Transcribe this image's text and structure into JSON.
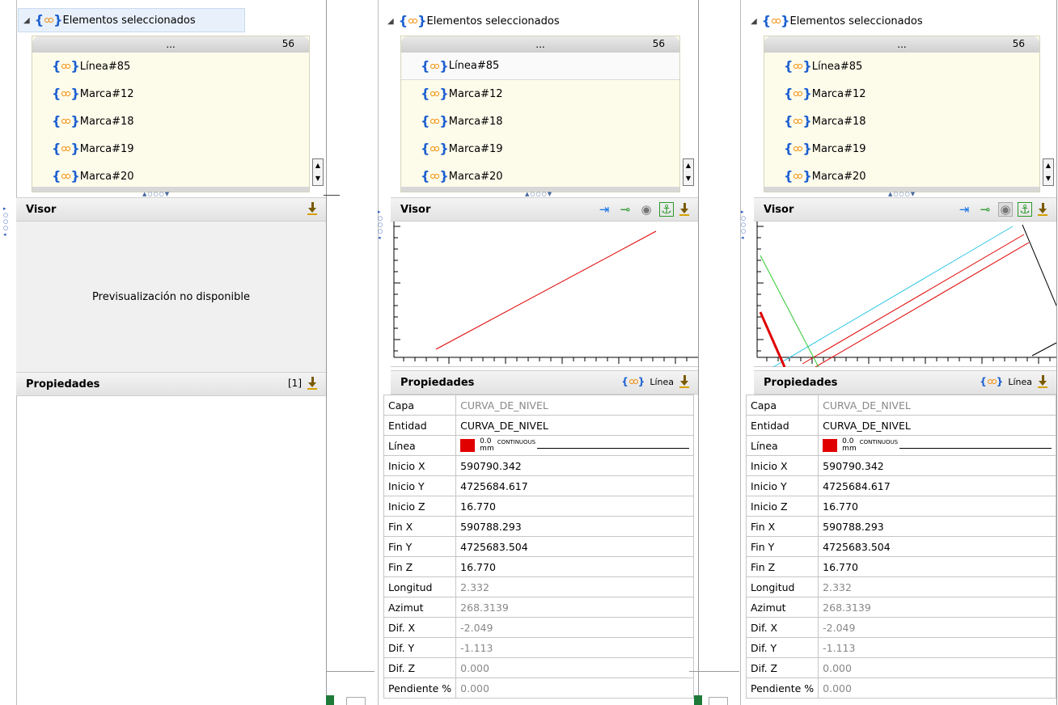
{
  "tree": {
    "title": "Elementos seleccionados",
    "header_ellipsis": "...",
    "header_count": "56",
    "items": [
      "Línea#85",
      "Marca#12",
      "Marca#18",
      "Marca#19",
      "Marca#20"
    ]
  },
  "viewer": {
    "label": "Visor",
    "unavailable": "Previsualización no disponible"
  },
  "properties": {
    "label": "Propiedades",
    "count_badge": "[1]",
    "entity_type": "Línea",
    "line_value": "0.0",
    "line_unit": "mm",
    "line_type": "CONTINUOUS",
    "rows": [
      {
        "key": "Capa",
        "value": "CURVA_DE_NIVEL",
        "muted": true
      },
      {
        "key": "Entidad",
        "value": "CURVA_DE_NIVEL",
        "muted": false
      },
      {
        "key": "Línea",
        "value": "",
        "muted": false
      },
      {
        "key": "Inicio X",
        "value": "590790.342",
        "muted": false
      },
      {
        "key": "Inicio Y",
        "value": "4725684.617",
        "muted": false
      },
      {
        "key": "Inicio Z",
        "value": "16.770",
        "muted": false
      },
      {
        "key": "Fin X",
        "value": "590788.293",
        "muted": false
      },
      {
        "key": "Fin Y",
        "value": "4725683.504",
        "muted": false
      },
      {
        "key": "Fin Z",
        "value": "16.770",
        "muted": false
      },
      {
        "key": "Longitud",
        "value": "2.332",
        "muted": true
      },
      {
        "key": "Azimut",
        "value": "268.3139",
        "muted": true
      },
      {
        "key": "Dif. X",
        "value": "-2.049",
        "muted": true
      },
      {
        "key": "Dif. Y",
        "value": "-1.113",
        "muted": true
      },
      {
        "key": "Dif. Z",
        "value": "0.000",
        "muted": true
      },
      {
        "key": "Pendiente %",
        "value": "0.000",
        "muted": true
      }
    ]
  },
  "colors": {
    "line_red": "#e00000",
    "line_cyan": "#2ec7e6",
    "line_green": "#2ec82e",
    "icon_blue": "#1c5fd0"
  },
  "toolbar_icons": [
    "exit-icon",
    "pin-icon",
    "eye-sigma-icon",
    "anchor-icon",
    "download-icon"
  ]
}
